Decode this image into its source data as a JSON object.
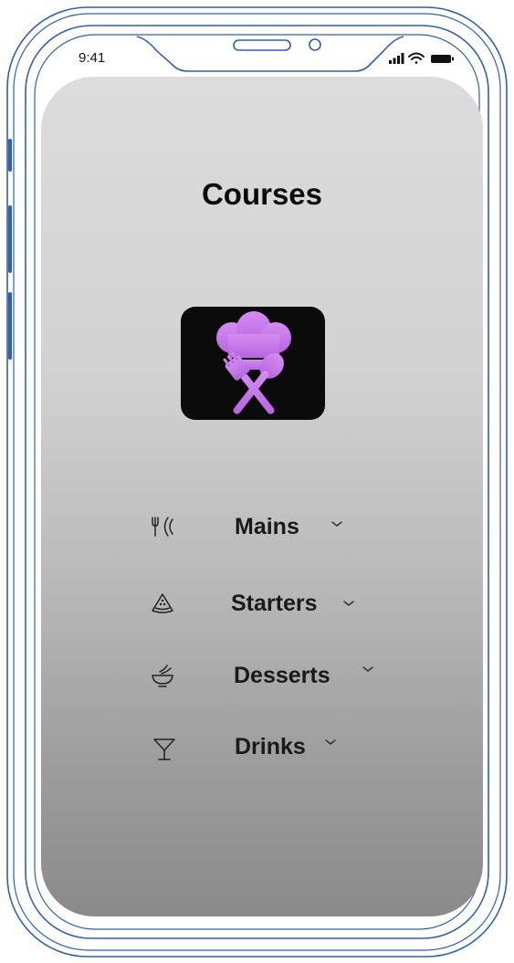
{
  "status_bar": {
    "time": "9:41",
    "signal_icon": "cellular-signal-icon",
    "wifi_icon": "wifi-icon",
    "battery_icon": "battery-icon"
  },
  "header": {
    "title": "Courses"
  },
  "logo": {
    "icon": "chef-hat-utensils-icon",
    "accent_color": "#c77ae8",
    "background_color": "#0b0b0b"
  },
  "menu": {
    "items": [
      {
        "label": "Mains",
        "icon": "fork-knife-plate-icon"
      },
      {
        "label": "Starters",
        "icon": "watermelon-slice-icon"
      },
      {
        "label": "Desserts",
        "icon": "dessert-bowl-icon"
      },
      {
        "label": "Drinks",
        "icon": "cocktail-glass-icon"
      }
    ],
    "chevron_icon": "chevron-down-icon"
  },
  "colors": {
    "frame_outline": "#2f5fb3",
    "title_text": "#0a0a0a"
  }
}
